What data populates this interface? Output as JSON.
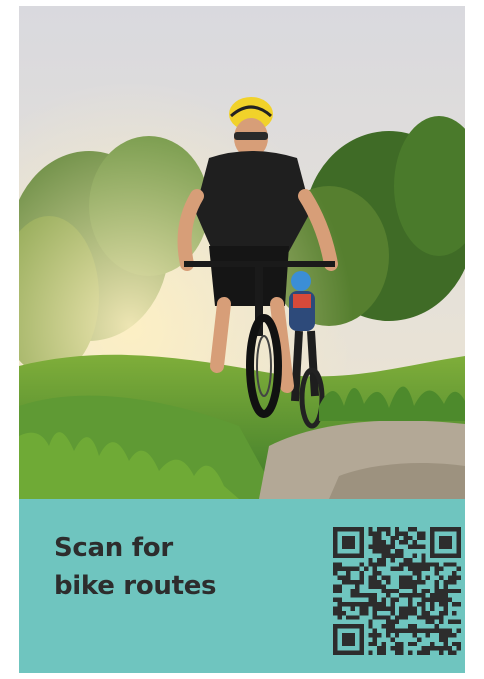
{
  "poster": {
    "cta_line_1": "Scan for",
    "cta_line_2": "bike routes",
    "banner_color": "#6fc5bf",
    "text_color": "#2d2d2d",
    "qr_color": "#2d2d2d"
  },
  "photo": {
    "subject": "father-and-child-mountain-biking-photo"
  },
  "qr_code": {
    "icon": "qr-code-icon"
  }
}
